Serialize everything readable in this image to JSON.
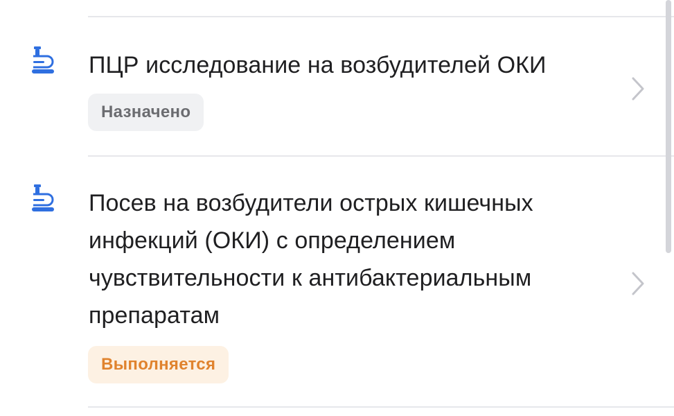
{
  "items": [
    {
      "icon": "microscope-icon",
      "title": "ПЦР исследование на возбудителей ОКИ",
      "status": "Назначено",
      "status_color": "#6b6c70",
      "status_bg": "#f0f1f3"
    },
    {
      "icon": "microscope-icon",
      "title_lines": [
        "Посев на возбудители острых кишечных",
        "инфекций (ОКИ) с определением",
        "чувствительности к антибактериальным",
        "препаратам"
      ],
      "status": "Выполняется",
      "status_color": "#e0832e",
      "status_bg": "#fdf1e3"
    }
  ],
  "colors": {
    "accent_blue": "#2f6fe0",
    "divider": "#e6e7eb",
    "chevron": "#c4c5cb"
  }
}
